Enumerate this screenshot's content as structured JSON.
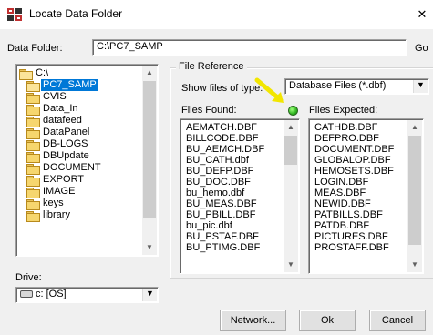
{
  "window": {
    "title": "Locate Data Folder",
    "close_glyph": "✕",
    "colors": {
      "selection": "#0078d7",
      "led": "#2fb520",
      "arrow": "#f2e600"
    }
  },
  "data_folder": {
    "label": "Data Folder:",
    "value": "C:\\PC7_SAMP",
    "go_label": "Go"
  },
  "directory_tree": [
    {
      "label": "C:\\",
      "icon": "open-folder-icon",
      "selected": false
    },
    {
      "label": "PC7_SAMP",
      "icon": "open-folder-icon",
      "selected": true
    },
    {
      "label": "CVIS",
      "icon": "folder-icon",
      "selected": false
    },
    {
      "label": "Data_In",
      "icon": "folder-icon",
      "selected": false
    },
    {
      "label": "datafeed",
      "icon": "folder-icon",
      "selected": false
    },
    {
      "label": "DataPanel",
      "icon": "folder-icon",
      "selected": false
    },
    {
      "label": "DB-LOGS",
      "icon": "folder-icon",
      "selected": false
    },
    {
      "label": "DBUpdate",
      "icon": "folder-icon",
      "selected": false
    },
    {
      "label": "DOCUMENT",
      "icon": "folder-icon",
      "selected": false
    },
    {
      "label": "EXPORT",
      "icon": "folder-icon",
      "selected": false
    },
    {
      "label": "IMAGE",
      "icon": "folder-icon",
      "selected": false
    },
    {
      "label": "keys",
      "icon": "folder-icon",
      "selected": false
    },
    {
      "label": "library",
      "icon": "folder-icon",
      "selected": false
    }
  ],
  "drive": {
    "label": "Drive:",
    "value": "c: [OS]"
  },
  "file_reference": {
    "title": "File Reference",
    "show_label": "Show files of type:",
    "type_value": "Database Files (*.dbf)",
    "found_label": "Files Found:",
    "expected_label": "Files Expected:",
    "found": [
      "AEMATCH.DBF",
      "BILLCODE.DBF",
      "BU_AEMCH.DBF",
      "BU_CATH.dbf",
      "BU_DEFP.DBF",
      "BU_DOC.DBF",
      "bu_hemo.dbf",
      "BU_MEAS.DBF",
      "BU_PBILL.DBF",
      "bu_pic.dbf",
      "BU_PSTAF.DBF",
      "BU_PTIMG.DBF"
    ],
    "expected": [
      "CATHDB.DBF",
      "DEFPRO.DBF",
      "DOCUMENT.DBF",
      "GLOBALOP.DBF",
      "HEMOSETS.DBF",
      "LOGIN.DBF",
      "MEAS.DBF",
      "NEWID.DBF",
      "PATBILLS.DBF",
      "PATDB.DBF",
      "PICTURES.DBF",
      "PROSTAFF.DBF"
    ]
  },
  "buttons": {
    "network": "Network...",
    "ok": "Ok",
    "cancel": "Cancel"
  }
}
